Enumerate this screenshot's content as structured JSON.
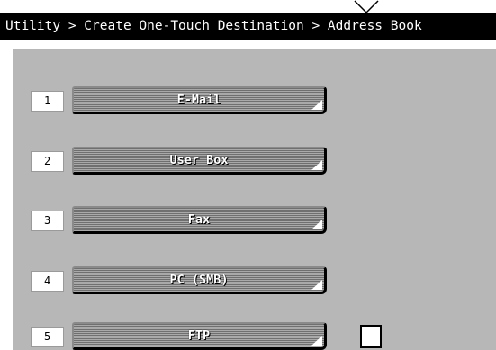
{
  "header": {
    "breadcrumb": "Utility > Create One-Touch Destination > Address Book"
  },
  "destinations": [
    {
      "number": "1",
      "label": "E-Mail"
    },
    {
      "number": "2",
      "label": "User Box"
    },
    {
      "number": "3",
      "label": "Fax"
    },
    {
      "number": "4",
      "label": "PC (SMB)"
    },
    {
      "number": "5",
      "label": "FTP"
    }
  ],
  "icons": {
    "top_indicator": "chevron-down-icon",
    "button_corner": "corner-triangle-icon"
  },
  "colors": {
    "header_bg": "#000000",
    "panel_bg": "#b7b7b7",
    "button_face": "#8e8e8e"
  }
}
